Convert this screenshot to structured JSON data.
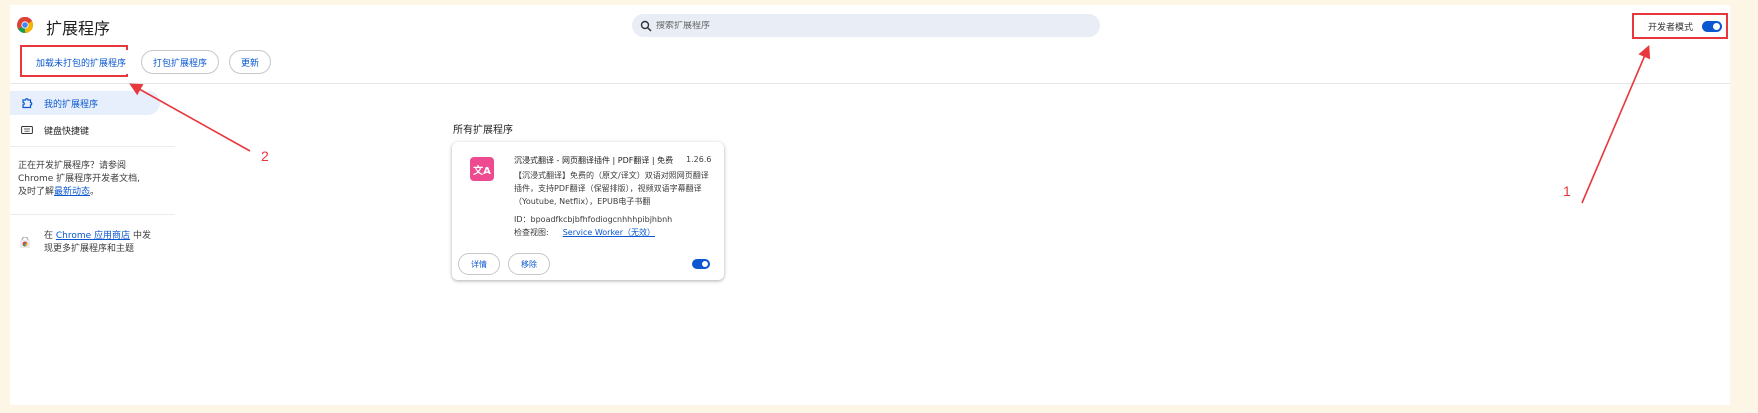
{
  "header": {
    "title": "扩展程序",
    "search_placeholder": "搜索扩展程序",
    "dev_mode_label": "开发者模式",
    "dev_mode_on": true
  },
  "toolbar": {
    "load_unpacked": "加载未打包的扩展程序",
    "pack_extension": "打包扩展程序",
    "update": "更新"
  },
  "sidebar": {
    "items": [
      {
        "label": "我的扩展程序",
        "icon": "puzzle-icon",
        "active": true
      },
      {
        "label": "键盘快捷键",
        "icon": "keyboard-icon",
        "active": false
      }
    ],
    "dev_note_1": "正在开发扩展程序？请参阅",
    "dev_note_2": "Chrome 扩展程序开发者文档,",
    "dev_note_3": "及时了解",
    "dev_note_link": "最新动态",
    "dev_note_end": "。",
    "store_prefix": "在",
    "store_link": "Chrome 应用商店",
    "store_suffix": "中发",
    "store_line2": "现更多扩展程序和主题"
  },
  "main": {
    "section_title": "所有扩展程序",
    "extension": {
      "name": "沉浸式翻译 - 网页翻译插件 | PDF翻译 | 免费",
      "version": "1.26.6",
      "description": "【沉浸式翻译】免费的（原文/译文）双语对照网页翻译插件，支持PDF翻译（保留排版），视频双语字幕翻译（Youtube, Netflix），EPUB电子书翻",
      "id_label": "ID：bpoadfkcbjbfhfodiogcnhhhpibjhbnh",
      "inspect_label": "检查视图:",
      "inspect_link": "Service Worker（无效）",
      "details_button": "详情",
      "remove_button": "移除",
      "enabled": true,
      "accent": "#ed4a8f"
    }
  },
  "annotations": {
    "label_1": "1",
    "label_2": "2",
    "color": "#e8383d"
  }
}
